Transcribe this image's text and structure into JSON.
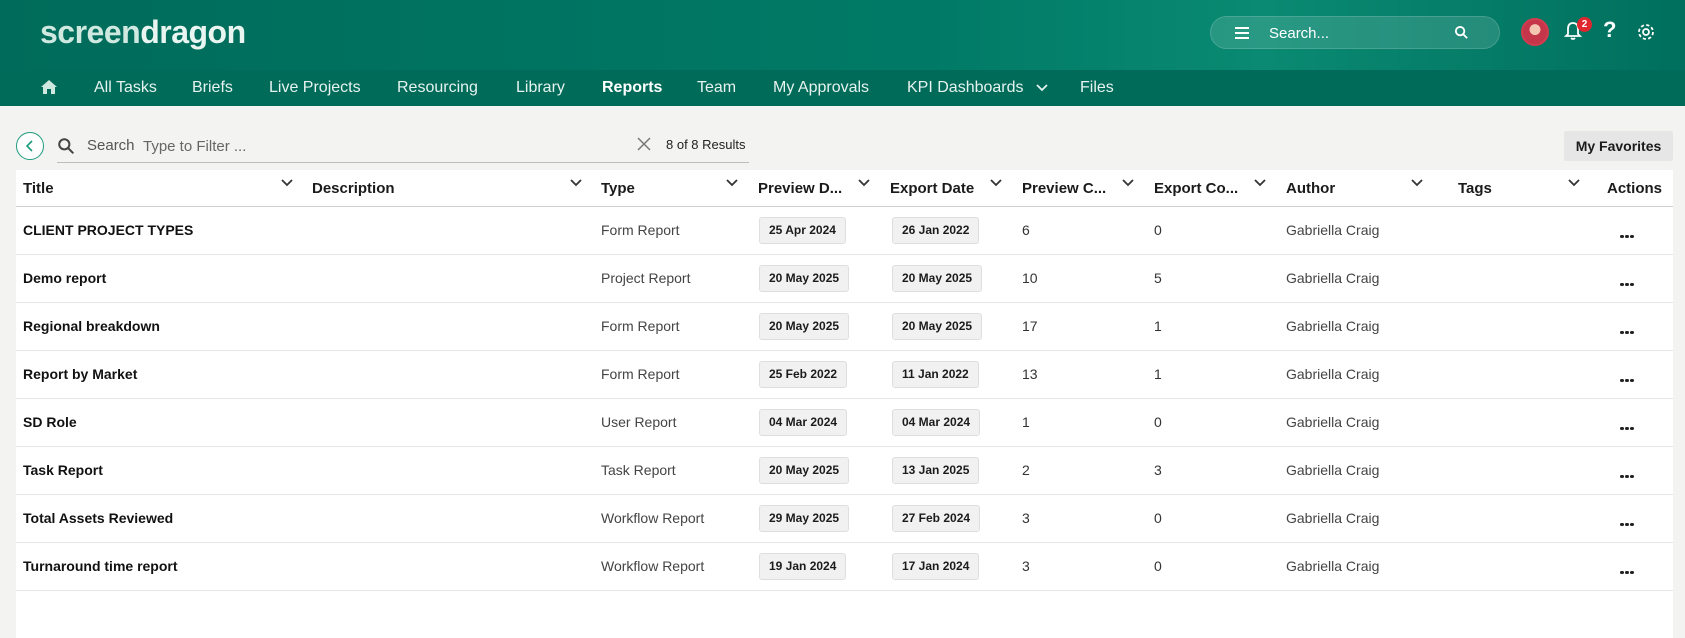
{
  "header": {
    "logo_part1": "screen",
    "logo_part2": "dragon",
    "search_placeholder": "Search...",
    "notification_count": "2",
    "help_label": "?"
  },
  "nav": {
    "items": [
      {
        "label": "All Tasks"
      },
      {
        "label": "Briefs"
      },
      {
        "label": "Live Projects"
      },
      {
        "label": "Resourcing"
      },
      {
        "label": "Library"
      },
      {
        "label": "Reports",
        "active": true
      },
      {
        "label": "Team"
      },
      {
        "label": "My Approvals"
      },
      {
        "label": "KPI Dashboards"
      },
      {
        "label": "Files"
      }
    ]
  },
  "filter": {
    "label": "Search",
    "placeholder": "Type to Filter ...",
    "results": "8 of 8 Results",
    "favorites_label": "My Favorites"
  },
  "table": {
    "columns": [
      "Title",
      "Description",
      "Type",
      "Preview D...",
      "Export Date",
      "Preview C...",
      "Export Co...",
      "Author",
      "Tags",
      "Actions"
    ],
    "rows": [
      {
        "title": "CLIENT PROJECT TYPES",
        "description": "",
        "type": "Form Report",
        "preview_date": "25 Apr 2024",
        "export_date": "26 Jan 2022",
        "preview_count": "6",
        "export_count": "0",
        "author": "Gabriella Craig",
        "tags": ""
      },
      {
        "title": "Demo report",
        "description": "",
        "type": "Project Report",
        "preview_date": "20 May 2025",
        "export_date": "20 May 2025",
        "preview_count": "10",
        "export_count": "5",
        "author": "Gabriella Craig",
        "tags": ""
      },
      {
        "title": "Regional breakdown",
        "description": "",
        "type": "Form Report",
        "preview_date": "20 May 2025",
        "export_date": "20 May 2025",
        "preview_count": "17",
        "export_count": "1",
        "author": "Gabriella Craig",
        "tags": ""
      },
      {
        "title": "Report by Market",
        "description": "",
        "type": "Form Report",
        "preview_date": "25 Feb 2022",
        "export_date": "11 Jan 2022",
        "preview_count": "13",
        "export_count": "1",
        "author": "Gabriella Craig",
        "tags": ""
      },
      {
        "title": "SD Role",
        "description": "",
        "type": "User Report",
        "preview_date": "04 Mar 2024",
        "export_date": "04 Mar 2024",
        "preview_count": "1",
        "export_count": "0",
        "author": "Gabriella Craig",
        "tags": ""
      },
      {
        "title": "Task Report",
        "description": "",
        "type": "Task Report",
        "preview_date": "20 May 2025",
        "export_date": "13 Jan 2025",
        "preview_count": "2",
        "export_count": "3",
        "author": "Gabriella Craig",
        "tags": ""
      },
      {
        "title": "Total Assets Reviewed",
        "description": "",
        "type": "Workflow Report",
        "preview_date": "29 May 2025",
        "export_date": "27 Feb 2024",
        "preview_count": "3",
        "export_count": "0",
        "author": "Gabriella Craig",
        "tags": ""
      },
      {
        "title": "Turnaround time report",
        "description": "",
        "type": "Workflow Report",
        "preview_date": "19 Jan 2024",
        "export_date": "17 Jan 2024",
        "preview_count": "3",
        "export_count": "0",
        "author": "Gabriella Craig",
        "tags": ""
      }
    ]
  },
  "colors": {
    "brand_teal": "#006b5a",
    "nav_bg": "#006b59",
    "accent_green": "#1c9b7c",
    "badge_red": "#e0262e"
  },
  "icons": [
    "menu-icon",
    "search-icon",
    "bell-icon",
    "help-icon",
    "gear-icon",
    "home-icon",
    "back-icon",
    "clear-icon",
    "chevron-down-icon",
    "more-icon"
  ]
}
